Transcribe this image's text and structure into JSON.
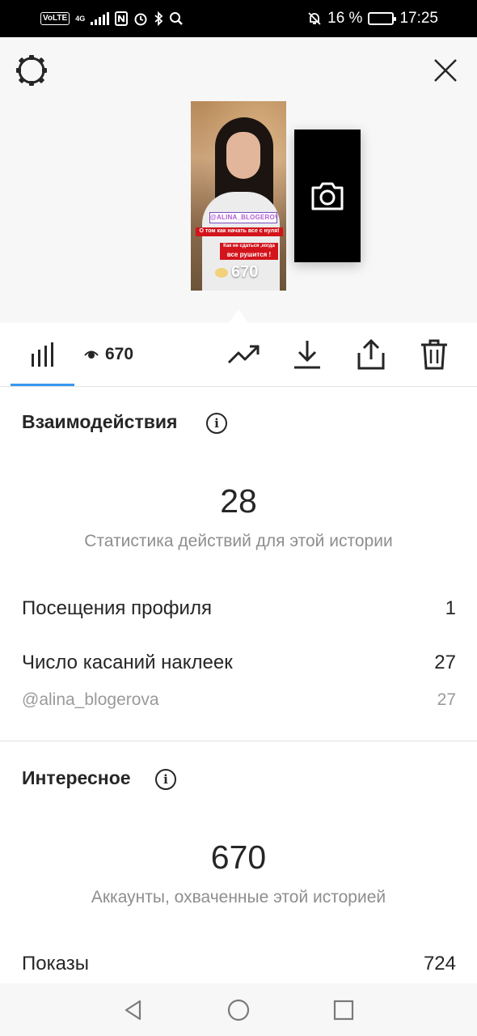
{
  "status_bar": {
    "network_badge": "VoLTE",
    "network_type": "4G",
    "battery_percent": "16 %",
    "battery_level": 0.16,
    "time": "17:25"
  },
  "preview": {
    "story_mention": "@ALINA_BLOGEROVA",
    "story_caption_1": "О том как начать все с нуля!",
    "story_caption_2": "Как не сдаться ,когда",
    "story_caption_3": "все рушится !",
    "story_views": "670"
  },
  "toolbar": {
    "views_count": "670"
  },
  "interactions": {
    "title": "Взаимодействия",
    "total": "28",
    "subtitle": "Статистика действий для этой истории",
    "rows": [
      {
        "label": "Посещения профиля",
        "value": "1"
      },
      {
        "label": "Число касаний наклеек",
        "value": "27"
      }
    ],
    "sub_row": {
      "label": "@alina_blogerova",
      "value": "27"
    }
  },
  "discovery": {
    "title": "Интересное",
    "total": "670",
    "subtitle": "Аккаунты, охваченные этой историей",
    "rows": [
      {
        "label": "Показы",
        "value": "724"
      }
    ]
  },
  "colors": {
    "accent": "#3897f0",
    "text": "#262626",
    "muted": "#8e8e8e"
  },
  "icons": {
    "settings": "gear-icon",
    "close": "close-icon",
    "camera": "camera-icon",
    "insights": "bar-chart-icon",
    "eye": "eye-icon",
    "promote": "trend-icon",
    "download": "download-icon",
    "share": "share-icon",
    "delete": "trash-icon",
    "info": "info-icon"
  }
}
